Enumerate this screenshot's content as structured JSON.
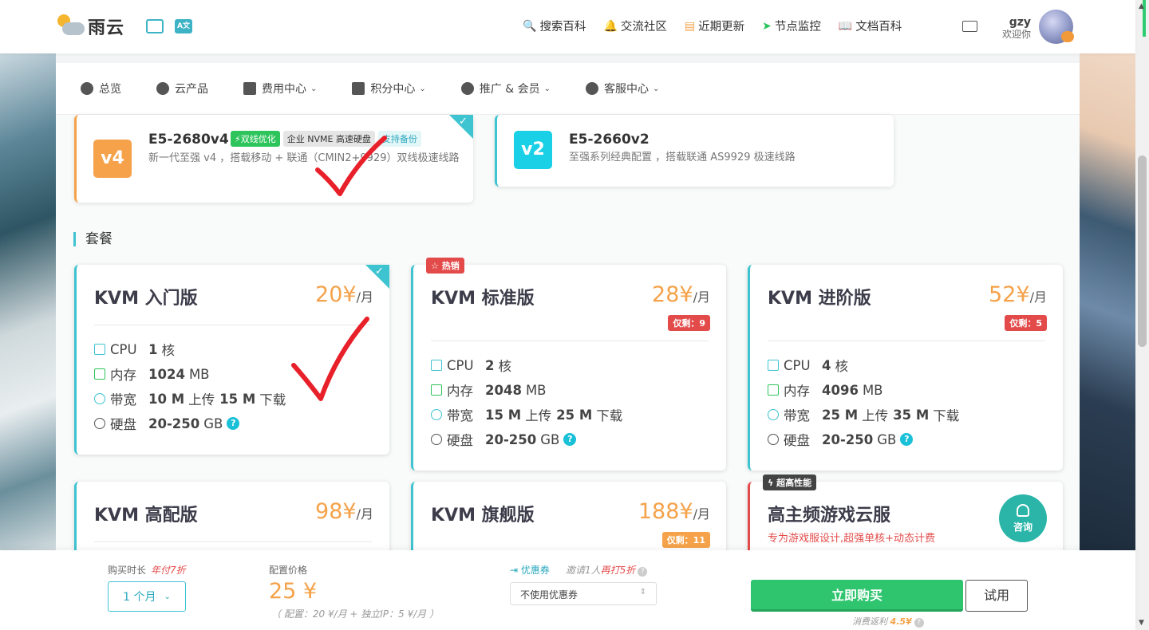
{
  "header": {
    "logo_text": "雨云",
    "translate_icon_text": "A文",
    "nav": [
      {
        "icon": "search-icon",
        "glyph": "🔍",
        "label": "搜索百科"
      },
      {
        "icon": "bell-icon",
        "glyph": "🔔",
        "label": "交流社区"
      },
      {
        "icon": "news-icon",
        "glyph": "▤",
        "label": "近期更新"
      },
      {
        "icon": "send-icon",
        "glyph": "➤",
        "label": "节点监控"
      },
      {
        "icon": "book-icon",
        "glyph": "📖",
        "label": "文档百科"
      }
    ],
    "user": {
      "name": "gzy",
      "welcome": "欢迎你"
    }
  },
  "subnav": [
    {
      "icon": "dashboard-icon",
      "label": "总览",
      "dropdown": false
    },
    {
      "icon": "cubes-icon",
      "label": "云产品",
      "dropdown": false
    },
    {
      "icon": "money-icon",
      "label": "费用中心",
      "dropdown": true
    },
    {
      "icon": "gift-icon",
      "label": "积分中心",
      "dropdown": true
    },
    {
      "icon": "users-icon",
      "label": "推广 & 会员",
      "dropdown": true
    },
    {
      "icon": "headset-icon",
      "label": "客服中心",
      "dropdown": true
    }
  ],
  "cpu_options": [
    {
      "badge": "v4",
      "title": "E5-2680v4",
      "tags": [
        "⚡双线优化",
        "企业 NVME 高速硬盘",
        "支持备份"
      ],
      "desc": "新一代至强 v4 ，搭载移动 + 联通（CMIN2+9929）双线极速线路",
      "selected": true
    },
    {
      "badge": "v2",
      "title": "E5-2660v2",
      "tags": [],
      "desc": "至强系列经典配置 ，搭载联通 AS9929 极速线路",
      "selected": false
    }
  ],
  "section_title": "套餐",
  "plans": [
    {
      "name": "KVM 入门版",
      "price": "20¥",
      "unit": "/月",
      "cpu": "1",
      "ram": "1024",
      "bw_up": "10 M",
      "bw_down": "15 M",
      "disk": "20-250",
      "remain": "",
      "flag": ""
    },
    {
      "name": "KVM 标准版",
      "price": "28¥",
      "unit": "/月",
      "cpu": "2",
      "ram": "2048",
      "bw_up": "15 M",
      "bw_down": "25 M",
      "disk": "20-250",
      "remain": "仅剩：9",
      "flag": "☆ 热销"
    },
    {
      "name": "KVM 进阶版",
      "price": "52¥",
      "unit": "/月",
      "cpu": "4",
      "ram": "4096",
      "bw_up": "25 M",
      "bw_down": "35 M",
      "disk": "20-250",
      "remain": "仅剩：5",
      "flag": ""
    },
    {
      "name": "KVM 高配版",
      "price": "98¥",
      "unit": "/月"
    },
    {
      "name": "KVM 旗舰版",
      "price": "188¥",
      "unit": "/月",
      "remain": "仅剩：11"
    },
    {
      "name": "高主频游戏云服",
      "sub": "专为游戏服设计,超强单核+动态计费",
      "flag": "ϟ 超高性能",
      "consult": "咨询"
    }
  ],
  "spec_labels": {
    "cpu": "CPU",
    "ram": "内存",
    "bw": "带宽",
    "disk": "硬盘",
    "core_unit": "核",
    "mb": "MB",
    "gb": "GB",
    "up": "上传",
    "down": "下载",
    "help": "?"
  },
  "bottom": {
    "duration_label": "购买时长",
    "duration_promo": "年付7折",
    "duration_value": "1 个月",
    "price_label": "配置价格",
    "price": "25 ¥",
    "price_note": "（ 配置：20 ¥/月 + 独立IP：5 ¥/月 ）",
    "coupon_label": "优惠券",
    "coupon_hint_a": "邀请1人",
    "coupon_hint_b": "再打5折",
    "coupon_value": "不使用优惠券",
    "buy_label": "立即购买",
    "try_label": "试用",
    "rebate_a": "消费返利",
    "rebate_b": "4.5¥"
  }
}
